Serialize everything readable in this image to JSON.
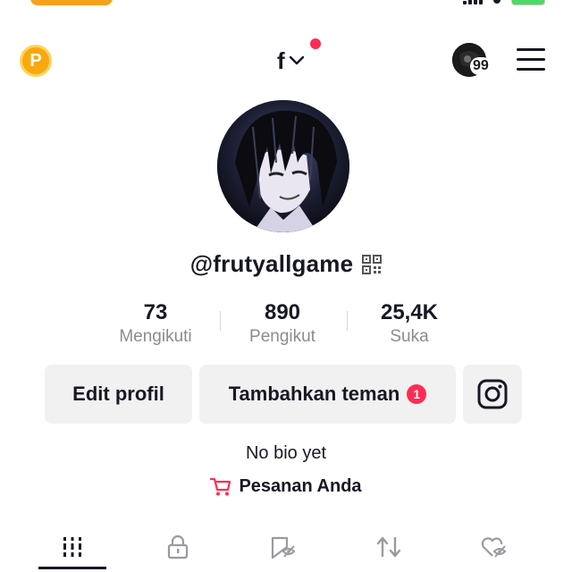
{
  "topbar": {
    "coin_letter": "P",
    "account_name": "f",
    "notification_count": "99"
  },
  "profile": {
    "username": "@frutyallgame"
  },
  "stats": [
    {
      "value": "73",
      "label": "Mengikuti"
    },
    {
      "value": "890",
      "label": "Pengikut"
    },
    {
      "value": "25,4K",
      "label": "Suka"
    }
  ],
  "actions": {
    "edit_profile": "Edit profil",
    "add_friends": "Tambahkan teman",
    "add_friends_badge": "1"
  },
  "bio": "No bio yet",
  "orders_label": "Pesanan Anda",
  "tabs": [
    {
      "icon": "videos-grid-icon",
      "active": true
    },
    {
      "icon": "private-lock-icon",
      "active": false
    },
    {
      "icon": "favorites-hidden-icon",
      "active": false
    },
    {
      "icon": "reposts-icon",
      "active": false
    },
    {
      "icon": "liked-hidden-icon",
      "active": false
    }
  ],
  "colors": {
    "accent_red": "#fe2c55",
    "coin_gold": "#f9a80f",
    "button_bg": "#f1f1f2",
    "muted_text": "#8a8b91"
  }
}
